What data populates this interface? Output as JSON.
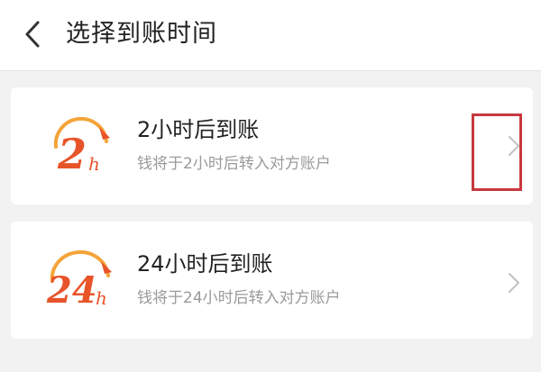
{
  "header": {
    "title": "选择到账时间",
    "back_icon": "chevron-left-icon"
  },
  "options": [
    {
      "logo_number": "2",
      "logo_unit": "h",
      "title": "2小时后到账",
      "description": "钱将于2小时后转入对方账户",
      "chevron_icon": "chevron-right-icon"
    },
    {
      "logo_number": "24",
      "logo_unit": "h",
      "title": "24小时后到账",
      "description": "钱将于24小时后转入对方账户",
      "chevron_icon": "chevron-right-icon"
    }
  ],
  "colors": {
    "logo_orange": "#e8542a",
    "logo_light": "#f4a43a",
    "highlight_red": "#c8383e"
  }
}
